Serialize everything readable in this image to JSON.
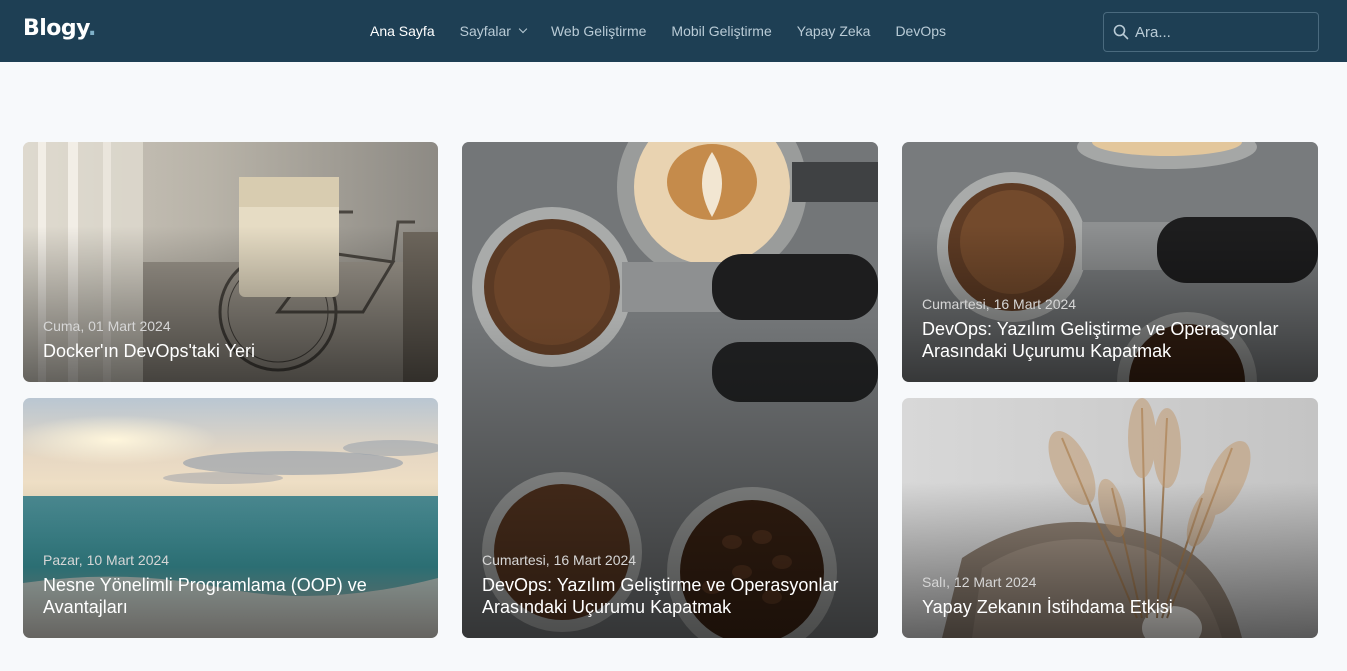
{
  "header": {
    "logo": "Blogy",
    "logo_dot": ".",
    "nav": [
      {
        "label": "Ana Sayfa",
        "active": true
      },
      {
        "label": "Sayfalar",
        "has_dropdown": true
      },
      {
        "label": "Web Geliştirme"
      },
      {
        "label": "Mobil Geliştirme"
      },
      {
        "label": "Yapay Zeka"
      },
      {
        "label": "DevOps"
      }
    ],
    "search": {
      "placeholder": "Ara...",
      "icon": "search-icon"
    }
  },
  "posts": [
    {
      "date": "Cuma, 01 Mart 2024",
      "title": "Docker'ın DevOps'taki Yeri",
      "image": "bicycle-photo"
    },
    {
      "date": "Pazar, 10 Mart 2024",
      "title": "Nesne Yönelimli Programlama (OOP) ve Avantajları",
      "image": "sea-sunset-photo"
    },
    {
      "date": "Cumartesi, 16 Mart 2024",
      "title": "DevOps: Yazılım Geliştirme ve Operasyonlar Arasındaki Uçurumu Kapatmak",
      "image": "coffee-portafilters-photo"
    },
    {
      "date": "Cumartesi, 16 Mart 2024",
      "title": "DevOps: Yazılım Geliştirme ve Operasyonlar Arasındaki Uçurumu Kapatmak",
      "image": "coffee-portafilters-photo"
    },
    {
      "date": "Salı, 12 Mart 2024",
      "title": "Yapay Zekanın İstihdama Etkisi",
      "image": "pampas-grass-photo"
    }
  ],
  "colors": {
    "navbar": "#1e3f54",
    "page_bg": "#f7f9fb",
    "nav_text": "#b9cbd6"
  }
}
